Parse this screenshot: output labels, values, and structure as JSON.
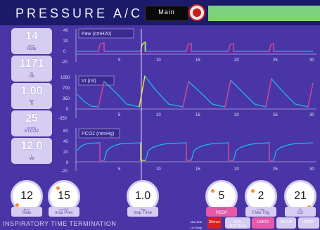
{
  "header": {
    "mode_title": "PRESSURE A/C",
    "main_label": "Main",
    "colors": {
      "title_bar": "#1c1a6a",
      "status_bar": "#7ed27e",
      "background": "#4a35a6"
    }
  },
  "measurements": [
    {
      "value": "14",
      "unit": "bpm",
      "name": "Rate"
    },
    {
      "value": "1171",
      "unit": "ml",
      "name": "Vti"
    },
    {
      "value": "1.00",
      "unit": "Sec",
      "name": "Ti"
    },
    {
      "value": "25",
      "unit": "mmHg",
      "name": "ETCO2"
    },
    {
      "value": "12.0",
      "unit": "L",
      "name": "Ve"
    }
  ],
  "waveforms": {
    "x_ticks": [
      "5",
      "10",
      "15",
      "20",
      "25",
      "30"
    ],
    "plots": [
      {
        "label": "Paw (cmH20)",
        "y_ticks": [
          "40",
          "20",
          "0",
          "-20"
        ]
      },
      {
        "label": "Vt (ml)",
        "y_ticks": [
          "1050",
          "700",
          "350",
          "0",
          "-350"
        ]
      },
      {
        "label": "PCO2 (mmHg)",
        "y_ticks": [
          "60",
          "40",
          "20",
          "0",
          "-20"
        ]
      }
    ],
    "colors": {
      "trace": "#1eb8e8",
      "inspiration": "#e83a8a",
      "marker": "#f0e020",
      "axis": "#e0e0ff"
    }
  },
  "controls": [
    {
      "value": "12",
      "unit": "bpm",
      "name": "Rate"
    },
    {
      "value": "15",
      "unit": "cmH2O",
      "name": "Insp Pres"
    },
    {
      "value": "1.0",
      "unit": "Sec",
      "name": "Insp Time"
    },
    {
      "value": "5",
      "unit": "cmH2O",
      "name": "PEEP"
    },
    {
      "value": "2",
      "unit": "L/min",
      "name": "Flow Trig"
    },
    {
      "value": "21",
      "unit": "%",
      "name": "O2"
    }
  ],
  "status": {
    "message": "INSPIRATORY TIME TERMINATION",
    "man_brth": "Man Brth",
    "lk_comp": "Lk Comp"
  },
  "buttons": {
    "silence": "Silence",
    "alarm_settings": "ADV SETTINGS",
    "limits": "LIMITS",
    "setup": "SETUP",
    "print": "PRINT"
  }
}
